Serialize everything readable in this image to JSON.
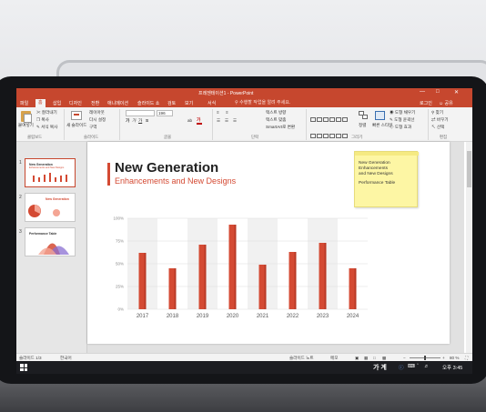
{
  "window": {
    "title": "프레젠테이션1 - PowerPoint",
    "controls": [
      "—",
      "□",
      "✕"
    ]
  },
  "ribbon_tabs": {
    "items": [
      "파일",
      "홈",
      "삽입",
      "디자인",
      "전환",
      "애니메이션",
      "슬라이드 쇼",
      "검토",
      "보기",
      "서식"
    ],
    "search_placeholder": "수행할 작업을 알려 주세요.",
    "sign_in": "로그인",
    "share": "공유"
  },
  "ribbon": {
    "paste": "붙여넣기",
    "cut": "잘라내기",
    "copy": "복사",
    "format_painter": "서식 복사",
    "new_slide": "새 슬라이드",
    "layout": "레이아웃",
    "reset": "다시 설정",
    "section": "구역",
    "font_size": "196",
    "text_direction": "텍스트 방향",
    "align_text": "텍스트 맞춤",
    "smartart": "SmartArt로 변환",
    "arrange": "정렬",
    "quick_styles": "빠른 스타일",
    "shape_fill": "도형 채우기",
    "shape_outline": "도형 윤곽선",
    "shape_effects": "도형 효과",
    "find": "찾기",
    "replace": "바꾸기",
    "select": "선택",
    "groups": {
      "clipboard": "클립보드",
      "slides": "슬라이드",
      "font": "글꼴",
      "paragraph": "단락",
      "drawing": "그리기",
      "editing": "편집"
    }
  },
  "slide": {
    "title": "New Generation",
    "subtitle": "Enhancements and New Designs",
    "sticky_note": [
      "New Generation",
      "Enhancements",
      "and New Designs",
      "Performance Table"
    ]
  },
  "thumbnails": [
    {
      "num": "1",
      "title": "New Generation",
      "subtitle": "Enhancements and New Designs"
    },
    {
      "num": "2",
      "title": "New Generation",
      "subtitle": ""
    },
    {
      "num": "3",
      "title": "Performance Table",
      "subtitle": ""
    }
  ],
  "statusbar": {
    "slide_count": "슬라이드 1/3",
    "language": "한국어",
    "notes": "슬라이드 노트",
    "comments": "메모",
    "zoom": "80 %"
  },
  "taskbar": {
    "ime": "가 계",
    "time": "오후 3:45"
  },
  "colors": {
    "accent": "#c6472e",
    "bar": "#d44a33",
    "sticky": "#fdf6a4"
  },
  "chart_data": {
    "type": "bar",
    "title": "",
    "xlabel": "",
    "ylabel": "",
    "categories": [
      "2017",
      "2018",
      "2019",
      "2020",
      "2021",
      "2022",
      "2023",
      "2024"
    ],
    "values": [
      62,
      45,
      71,
      93,
      49,
      63,
      73,
      45
    ],
    "ylim": [
      0,
      100
    ],
    "yticks": [
      "0%",
      "25%",
      "50%",
      "75%",
      "100%"
    ],
    "grid": true
  }
}
